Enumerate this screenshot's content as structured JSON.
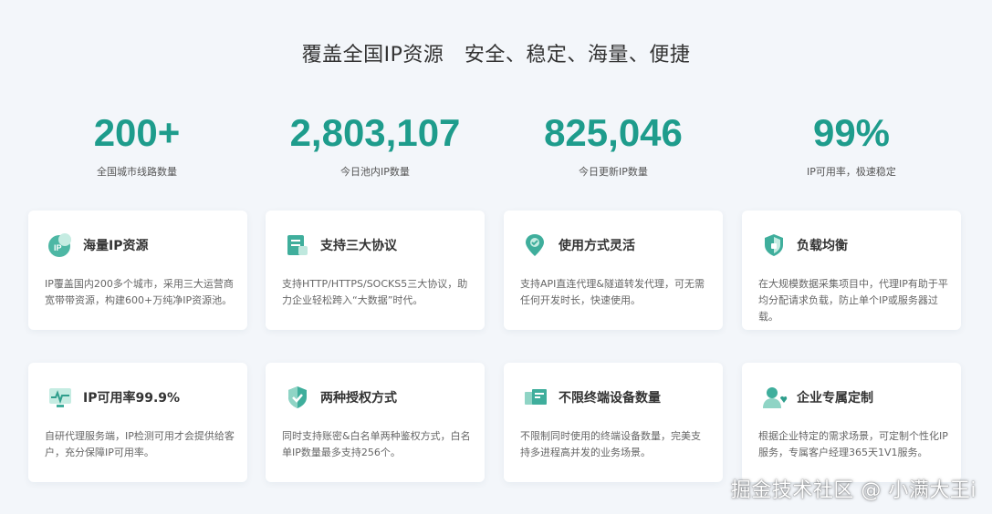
{
  "title": "覆盖全国IP资源   安全、稳定、海量、便捷",
  "stats": [
    {
      "value": "200+",
      "caption": "全国城市线路数量"
    },
    {
      "value": "2,803,107",
      "caption": "今日池内IP数量"
    },
    {
      "value": "825,046",
      "caption": "今日更新IP数量"
    },
    {
      "value": "99%",
      "caption": "IP可用率，极速稳定"
    }
  ],
  "cards": [
    {
      "icon": "ip-globe-icon",
      "title": "海量IP资源",
      "desc": "IP覆盖国内200多个城市，采用三大运营商宽带带资源，构建600+万纯净IP资源池。"
    },
    {
      "icon": "document-protocol-icon",
      "title": "支持三大协议",
      "desc": "支持HTTP/HTTPS/SOCKS5三大协议，助力企业轻松跨入“大数据”时代。"
    },
    {
      "icon": "location-pin-icon",
      "title": "使用方式灵活",
      "desc": "支持API直连代理&隧道转发代理，可无需任何开发时长，快速使用。"
    },
    {
      "icon": "shield-lock-icon",
      "title": "负载均衡",
      "desc": "在大规模数据采集项目中，代理IP有助于平均分配请求负载，防止单个IP或服务器过载。"
    },
    {
      "icon": "monitor-pulse-icon",
      "title": "IP可用率99.9%",
      "desc": "自研代理服务端，IP检测可用才会提供给客户，充分保障IP可用率。"
    },
    {
      "icon": "shield-check-icon",
      "title": "两种授权方式",
      "desc": "同时支持账密&白名单两种鉴权方式，白名单IP数量最多支持256个。"
    },
    {
      "icon": "devices-icon",
      "title": "不限终端设备数量",
      "desc": "不限制同时使用的终端设备数量，完美支持多进程高并发的业务场景。"
    },
    {
      "icon": "user-heart-icon",
      "title": "企业专属定制",
      "desc": "根据企业特定的需求场景，可定制个性化IP服务，专属客户经理365天1V1服务。"
    }
  ],
  "watermark": "掘金技术社区 @ 小满大王i",
  "colors": {
    "accent": "#1e9c8c",
    "background": "#f3f6fa"
  }
}
